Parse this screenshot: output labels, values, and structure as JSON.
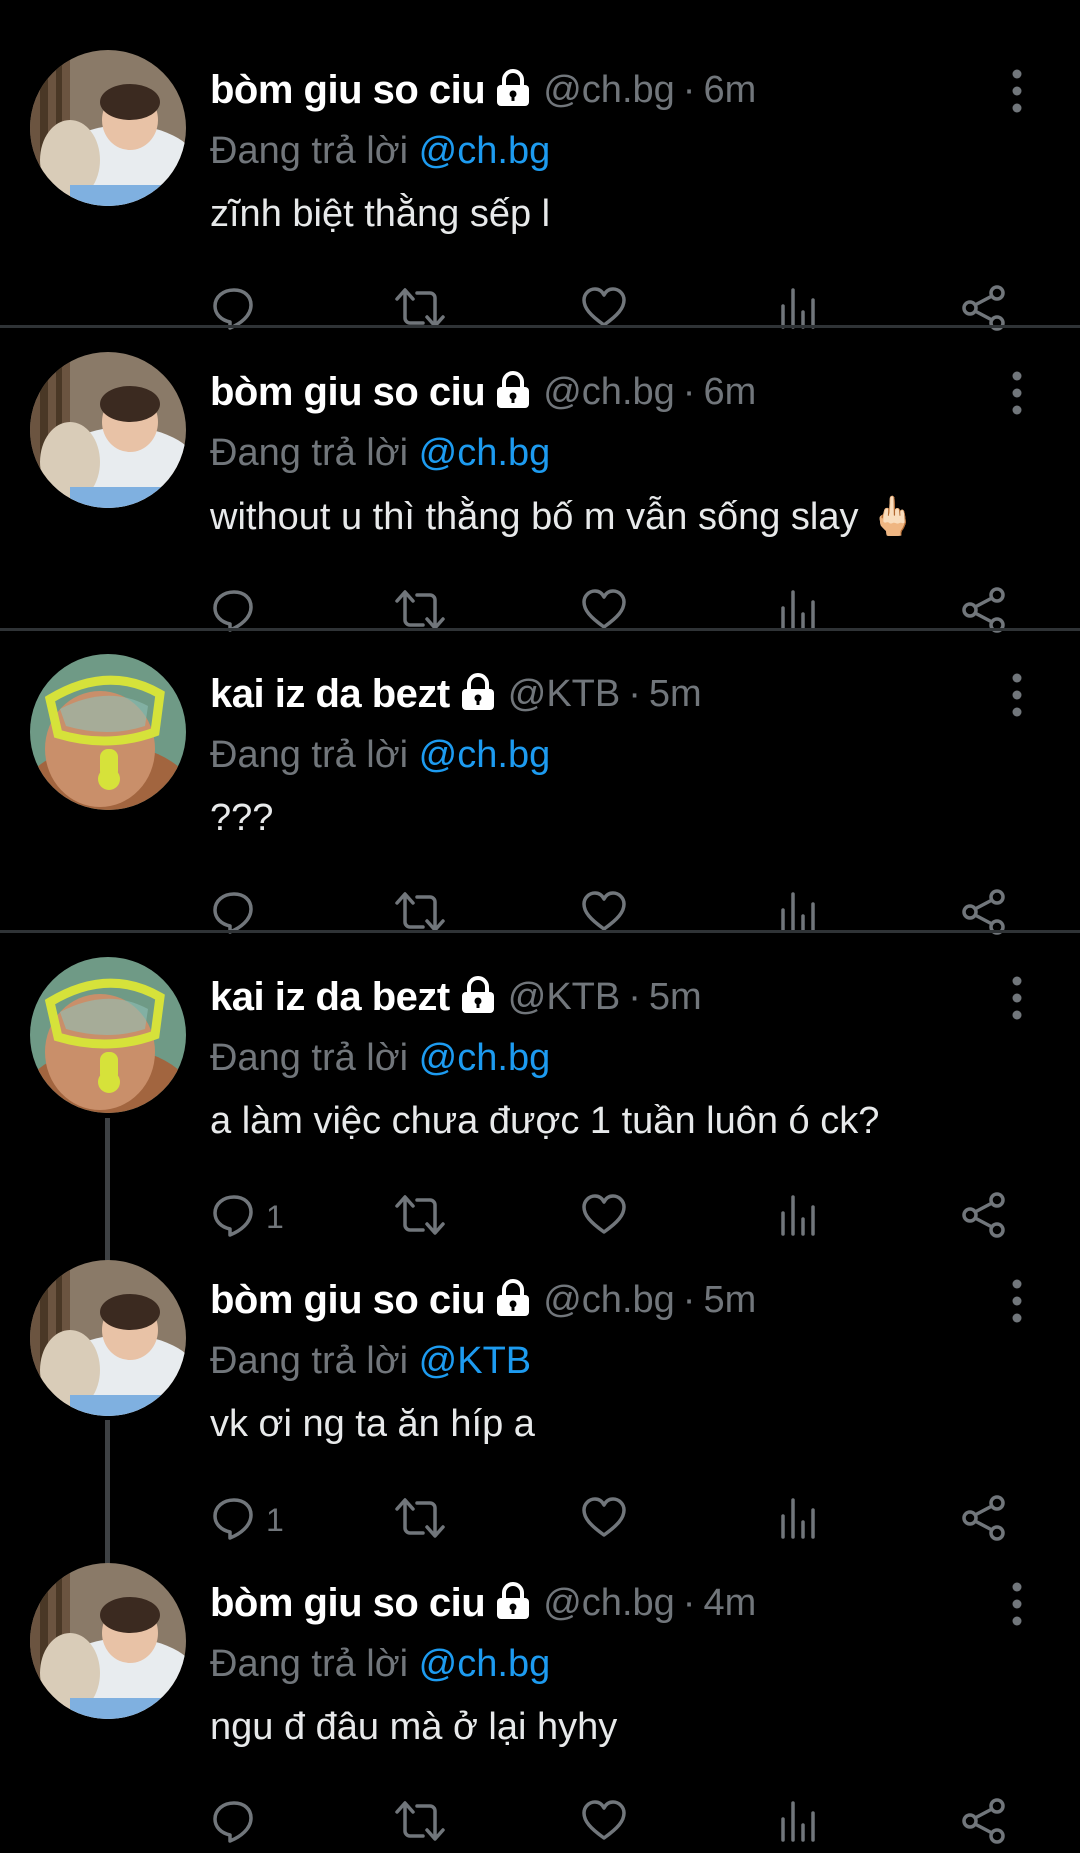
{
  "tweets": [
    {
      "name": "bòm giu so ciu",
      "handle": "@ch.bg",
      "dot": "·",
      "time": "6m",
      "replying_prefix": "Đang trả lời",
      "replying_to": "@ch.bg",
      "text": "zĩnh biệt thằng sếp l",
      "reply_count": "",
      "avatar": "sleeping-baby"
    },
    {
      "name": "bòm giu so ciu",
      "handle": "@ch.bg",
      "dot": "·",
      "time": "6m",
      "replying_prefix": "Đang trả lời",
      "replying_to": "@ch.bg",
      "text": "without u thì thằng bố m vẫn sống slay 🖕🏻",
      "reply_count": "",
      "avatar": "sleeping-baby"
    },
    {
      "name": "kai iz da bezt",
      "handle": "@KTB",
      "dot": "·",
      "time": "5m",
      "replying_prefix": "Đang trả lời",
      "replying_to": "@ch.bg",
      "text": "???",
      "reply_count": "",
      "avatar": "snorkel-kid"
    },
    {
      "name": "kai iz da bezt",
      "handle": "@KTB",
      "dot": "·",
      "time": "5m",
      "replying_prefix": "Đang trả lời",
      "replying_to": "@ch.bg",
      "text": "a làm việc chưa được 1 tuần luôn ó ck?",
      "reply_count": "1",
      "avatar": "snorkel-kid"
    },
    {
      "name": "bòm giu so ciu",
      "handle": "@ch.bg",
      "dot": "·",
      "time": "5m",
      "replying_prefix": "Đang trả lời",
      "replying_to": "@KTB",
      "text": "vk ơi ng ta ăn híp a",
      "reply_count": "1",
      "avatar": "sleeping-baby"
    },
    {
      "name": "bòm giu so ciu",
      "handle": "@ch.bg",
      "dot": "·",
      "time": "4m",
      "replying_prefix": "Đang trả lời",
      "replying_to": "@ch.bg",
      "text": "ngu đ đâu mà ở lại hyhy",
      "reply_count": "",
      "avatar": "sleeping-baby"
    }
  ],
  "icons": {
    "reply": "reply-icon",
    "retweet": "retweet-icon",
    "like": "like-icon",
    "views": "views-icon",
    "share": "share-icon",
    "more": "more-icon",
    "lock": "lock-icon"
  },
  "colors": {
    "background": "#000000",
    "text": "#e7e9ea",
    "muted": "#71767b",
    "mention": "#1d9bf0",
    "divider": "#2f3336"
  }
}
